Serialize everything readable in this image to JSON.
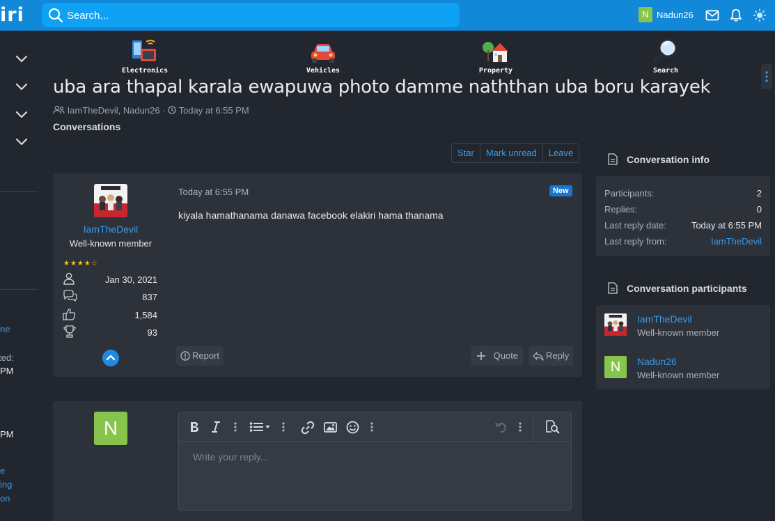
{
  "header": {
    "logo_text": "iri",
    "search_placeholder": "Search...",
    "user_initial": "N",
    "username": "Nadun26"
  },
  "sidebar": {
    "fragments": [
      "ne",
      "ted:",
      "PM",
      "PM",
      "e",
      "ing",
      "on"
    ]
  },
  "categories": [
    {
      "label": "Electronics",
      "icon": "electronics-icon"
    },
    {
      "label": "Vehicles",
      "icon": "car-icon"
    },
    {
      "label": "Property",
      "icon": "house-icon"
    },
    {
      "label": "Search",
      "icon": "magnifier-icon"
    }
  ],
  "thread": {
    "title": "uba ara thapal karala ewapuwa photo damme naththan uba boru karayek",
    "participants_meta": "IamTheDevil, Nadun26",
    "separator": "·",
    "date_meta": "Today at 6:55 PM",
    "breadcrumb": "Conversations"
  },
  "actions": {
    "star": "Star",
    "mark_unread": "Mark unread",
    "leave": "Leave"
  },
  "message": {
    "author": "IamTheDevil",
    "author_title": "Well-known member",
    "rating": 4.5,
    "stars_text": "★★★★☆",
    "joined": "Jan 30, 2021",
    "messages": "837",
    "reactions": "1,584",
    "points": "93",
    "date": "Today at 6:55 PM",
    "badge": "New",
    "body": "kiyala hamathanama danawa facebook elakiri hama thanama",
    "report_label": "Report",
    "quote_label": "Quote",
    "reply_label": "Reply"
  },
  "conversation_info": {
    "title": "Conversation info",
    "rows": [
      {
        "label": "Participants:",
        "value": "2"
      },
      {
        "label": "Replies:",
        "value": "0"
      },
      {
        "label": "Last reply date:",
        "value": "Today at 6:55 PM"
      },
      {
        "label": "Last reply from:",
        "value": "IamTheDevil"
      }
    ]
  },
  "participants": {
    "title": "Conversation participants",
    "list": [
      {
        "name": "IamTheDevil",
        "title": "Well-known member"
      },
      {
        "name": "Nadun26",
        "title": "Well-known member",
        "initial": "N"
      }
    ]
  },
  "reply_box": {
    "avatar_initial": "N",
    "placeholder": "Write your reply..."
  },
  "colors": {
    "topbar": "#1288d8",
    "link": "#3a9ae6",
    "background": "#22262e",
    "panel": "#2c313a",
    "avatar_green": "#87c44c"
  }
}
